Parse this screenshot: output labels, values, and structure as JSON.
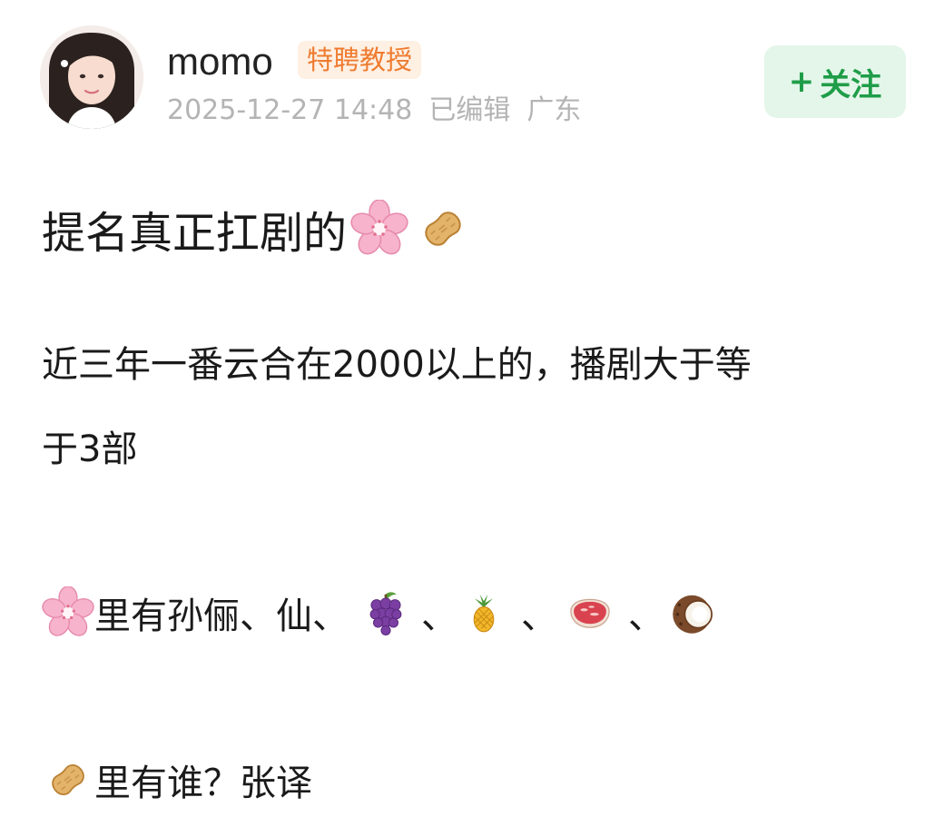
{
  "author": {
    "name": "momo",
    "badge": "特聘教授",
    "timestamp": "2025-12-27 14:48",
    "edited_label": "已编辑",
    "location": "广东"
  },
  "follow_button": {
    "plus": "+",
    "label": "关注"
  },
  "post": {
    "title": "提名真正扛剧的",
    "paragraph1_line1": "近三年一番云合在2000以上的，播剧大于等",
    "paragraph1_line2": "于3部",
    "flower_line_text": "里有孙俪、仙、",
    "separator": "、",
    "peanut_line_text": "里有谁？张译"
  },
  "icons": {
    "title_icons": [
      "cherry-blossom-icon",
      "peanut-icon"
    ],
    "flower_line_icons": [
      "cherry-blossom-icon",
      "grapes-icon",
      "pineapple-icon",
      "meat-icon",
      "coconut-icon"
    ],
    "peanut_line_icons": [
      "peanut-icon"
    ]
  },
  "colors": {
    "badge_text": "#ee7b2f",
    "badge_bg": "#fff0e4",
    "follow_text": "#1f9d48",
    "follow_bg": "#e4f6ea",
    "meta_text": "#b4b4b4"
  }
}
